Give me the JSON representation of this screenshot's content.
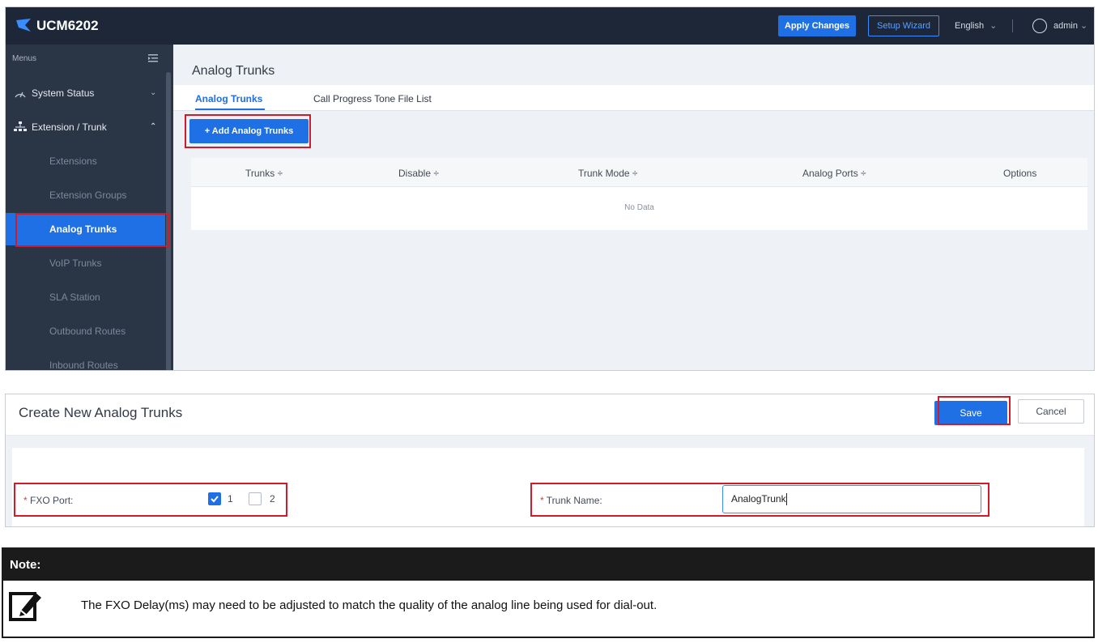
{
  "app": {
    "product": "UCM6202",
    "apply_changes": "Apply Changes",
    "setup_wizard": "Setup Wizard",
    "language": "English",
    "user": "admin"
  },
  "sidebar": {
    "header": "Menus",
    "items": [
      {
        "label": "System Status",
        "type": "group",
        "icon": "speedometer-icon"
      },
      {
        "label": "Extension / Trunk",
        "type": "group",
        "icon": "network-icon"
      },
      {
        "label": "Extensions",
        "type": "sub"
      },
      {
        "label": "Extension Groups",
        "type": "sub"
      },
      {
        "label": "Analog Trunks",
        "type": "sub",
        "active": true
      },
      {
        "label": "VoIP Trunks",
        "type": "sub"
      },
      {
        "label": "SLA Station",
        "type": "sub"
      },
      {
        "label": "Outbound Routes",
        "type": "sub"
      },
      {
        "label": "Inbound Routes",
        "type": "sub"
      }
    ]
  },
  "main": {
    "title": "Analog Trunks",
    "tabs": [
      {
        "label": "Analog Trunks",
        "active": true
      },
      {
        "label": "Call Progress Tone File List",
        "active": false
      }
    ],
    "add_button": "+ Add Analog Trunks",
    "table": {
      "columns": [
        "Trunks ÷",
        "Disable ÷",
        "Trunk Mode ÷",
        "Analog Ports ÷",
        "Options"
      ],
      "empty_text": "No Data"
    }
  },
  "create_form": {
    "title": "Create New Analog Trunks",
    "save": "Save",
    "cancel": "Cancel",
    "fxo_port_label": "FXO Port:",
    "required_mark": "*",
    "ports": [
      {
        "label": "1",
        "checked": true
      },
      {
        "label": "2",
        "checked": false
      }
    ],
    "trunk_name_label": "Trunk Name:",
    "trunk_name_value": "AnalogTrunk"
  },
  "note": {
    "heading": "Note:",
    "text": "The FXO Delay(ms) may need to be adjusted to match the quality of the analog line being used for dial-out."
  },
  "colors": {
    "topbar": "#1d2738",
    "sidebar": "#2a3546",
    "accent": "#1f6fe5",
    "highlight": "#d11b2a"
  }
}
